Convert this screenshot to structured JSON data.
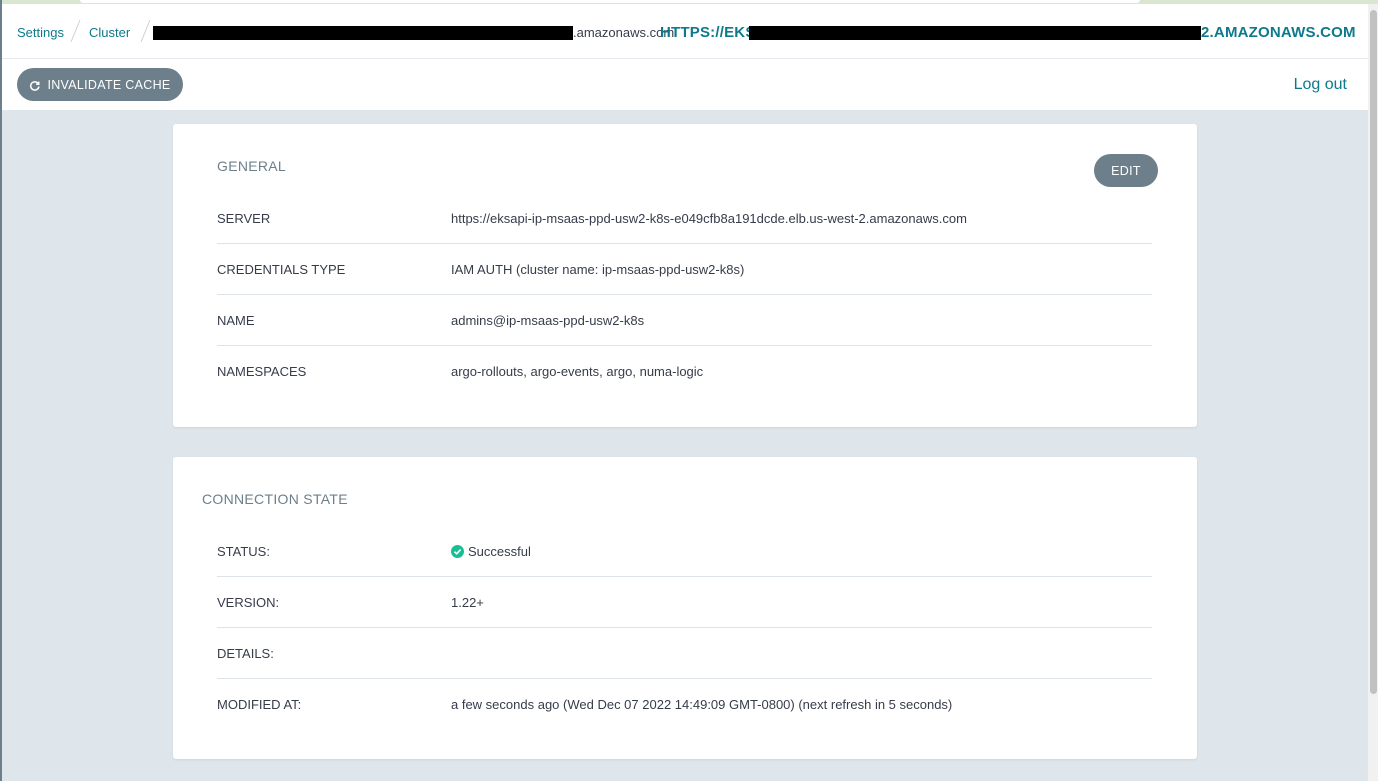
{
  "breadcrumb": {
    "settings": "Settings",
    "cluster": "Cluster",
    "cluster_suffix": ".amazonaws.com",
    "title_prefix": "HTTPS://EKS",
    "title_suffix": "2.AMAZONAWS.COM"
  },
  "toolbar": {
    "invalidate_label": "INVALIDATE CACHE",
    "logout_label": "Log out"
  },
  "general": {
    "title": "GENERAL",
    "edit_label": "EDIT",
    "rows": [
      {
        "key": "SERVER",
        "value": "https://eksapi-ip-msaas-ppd-usw2-k8s-e049cfb8a191dcde.elb.us-west-2.amazonaws.com"
      },
      {
        "key": "CREDENTIALS TYPE",
        "value": "IAM AUTH (cluster name: ip-msaas-ppd-usw2-k8s)"
      },
      {
        "key": "NAME",
        "value": "admins@ip-msaas-ppd-usw2-k8s"
      },
      {
        "key": "NAMESPACES",
        "value": "argo-rollouts, argo-events, argo, numa-logic"
      }
    ]
  },
  "connection": {
    "title": "CONNECTION STATE",
    "rows": [
      {
        "key": "STATUS:",
        "value": "Successful"
      },
      {
        "key": "VERSION:",
        "value": "1.22+"
      },
      {
        "key": "DETAILS:",
        "value": ""
      },
      {
        "key": "MODIFIED AT:",
        "value": "a few seconds ago (Wed Dec 07 2022 14:49:09 GMT-0800) (next refresh in 5 seconds)"
      }
    ]
  },
  "colors": {
    "accent": "#0c7a8c",
    "button": "#6d7f8b",
    "background": "#dee6eb",
    "success": "#18be94"
  }
}
